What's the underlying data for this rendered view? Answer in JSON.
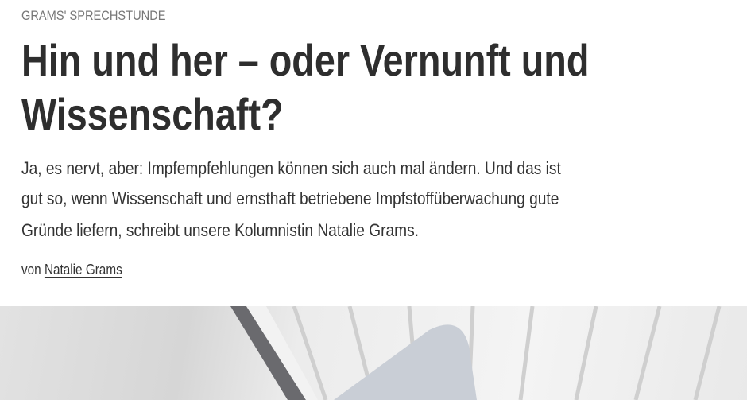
{
  "article": {
    "kicker": "GRAMS' SPRECHSTUNDE",
    "title_lines": [
      "Hin und her – oder Vernunft und",
      "Wissenschaft?"
    ],
    "lead_lines": [
      "Ja, es nervt, aber: Impfempfehlungen können sich auch mal ändern. Und das ist",
      "gut so, wenn Wissenschaft und ernsthaft betriebene Impfstoffüberwachung gute",
      "Gründe liefern, schreibt unsere Kolumnistin Natalie Grams."
    ],
    "byline_prefix": "von",
    "author": "Natalie Grams"
  }
}
